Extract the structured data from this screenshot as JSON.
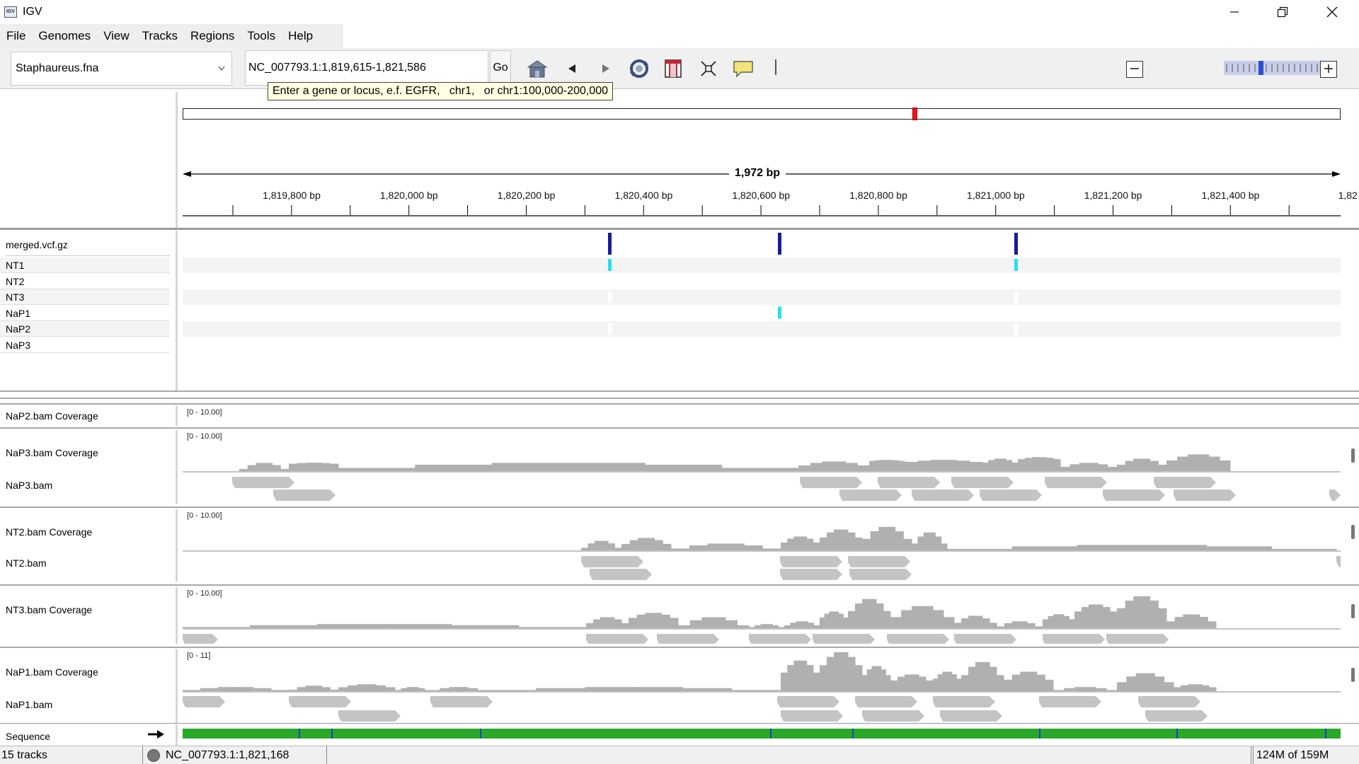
{
  "window": {
    "title": "IGV",
    "icon_text": "IGV"
  },
  "menu": [
    "File",
    "Genomes",
    "View",
    "Tracks",
    "Regions",
    "Tools",
    "Help"
  ],
  "toolbar": {
    "genome": "Staphaureus.fna",
    "locus": "NC_007793.1:1,819,615-1,821,586",
    "go_label": "Go",
    "tooltip": "Enter a gene or locus, e.f. EGFR,   chr1,   or chr1:100,000-200,000",
    "icons": [
      "home-icon",
      "back-icon",
      "forward-icon",
      "refresh-icon",
      "region-of-interest-icon",
      "fit-to-window-icon",
      "popup-info-icon"
    ],
    "zoom_level": 9,
    "zoom_ticks": 24
  },
  "ruler": {
    "span_label": "1,972 bp",
    "ticks": [
      "1,819,800 bp",
      "1,820,000 bp",
      "1,820,200 bp",
      "1,820,400 bp",
      "1,820,600 bp",
      "1,820,800 bp",
      "1,821,000 bp",
      "1,821,200 bp",
      "1,821,400 bp",
      "1,82"
    ]
  },
  "variants": {
    "track_name": "merged.vcf.gz",
    "samples": [
      "NT1",
      "NT2",
      "NT3",
      "NaP1",
      "NaP2",
      "NaP3"
    ]
  },
  "tracks": [
    {
      "id": "nap2",
      "coverage_label": "NaP2.bam Coverage",
      "range": "[0 - 10.00]"
    },
    {
      "id": "nap3",
      "coverage_label": "NaP3.bam Coverage",
      "bam_label": "NaP3.bam",
      "range": "[0 - 10.00]"
    },
    {
      "id": "nt2",
      "coverage_label": "NT2.bam Coverage",
      "bam_label": "NT2.bam",
      "range": "[0 - 10.00]"
    },
    {
      "id": "nt3",
      "coverage_label": "NT3.bam Coverage",
      "range": "[0 - 10.00]"
    },
    {
      "id": "nap1",
      "coverage_label": "NaP1.bam Coverage",
      "bam_label": "NaP1.bam",
      "range": "[0 - 11]"
    }
  ],
  "sequence": {
    "label": "Sequence"
  },
  "status": {
    "tracks": "15 tracks",
    "position": "NC_007793.1:1,821,168",
    "memory": "124M of 159M"
  },
  "colors": {
    "variant_site": "#1a1a9c",
    "genotype_het": "#22e1f0",
    "coverage": "#b0b0b0",
    "reads": "#c4c4c4"
  }
}
